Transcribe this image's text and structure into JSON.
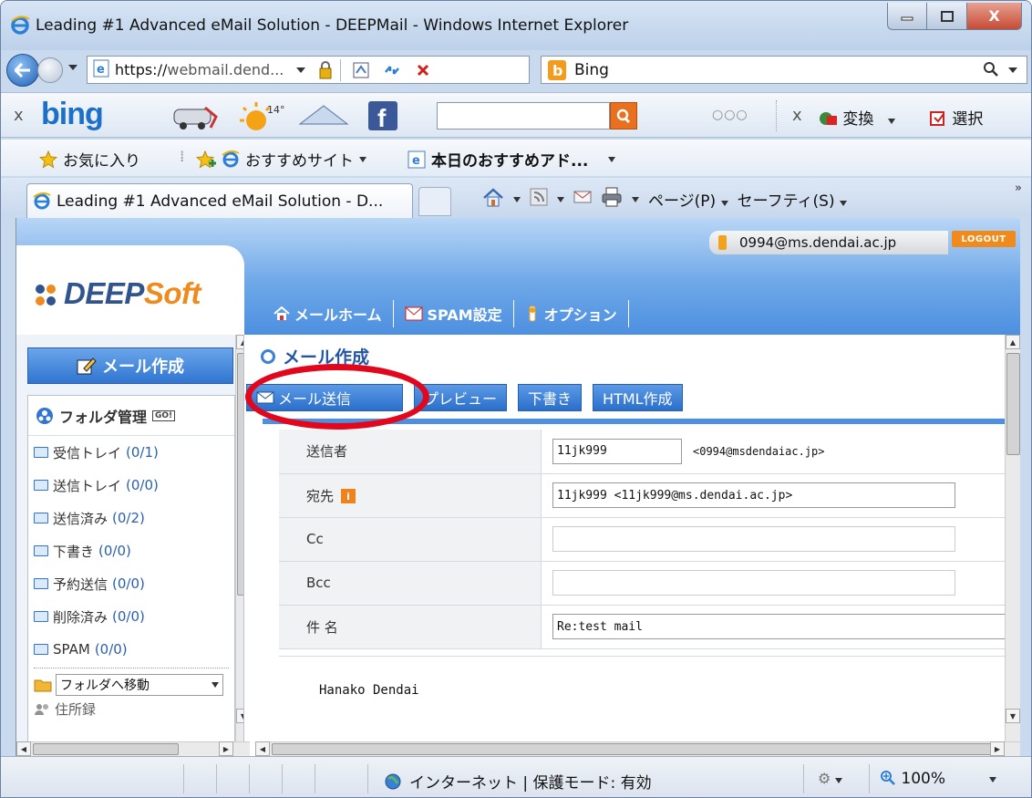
{
  "window": {
    "title": "Leading #1 Advanced eMail Solution - DEEPMail - Windows Internet Explorer"
  },
  "address_bar": {
    "url_prefix": "https://",
    "url_main": "webmail.dend...",
    "search_engine": "Bing"
  },
  "bing_toolbar": {
    "logo": "bing",
    "weather": "14°",
    "dots": "○○○",
    "convert_label": "変換",
    "select_label": "選択"
  },
  "favorites_bar": {
    "favorites_label": "お気に入り",
    "recommended_sites": "おすすめサイト",
    "todays_addons": "本日のおすすめアド..."
  },
  "tab_bar": {
    "active_tab_title": "Leading #1 Advanced eMail Solution - D...",
    "page_menu": "ページ(P)",
    "safety_menu": "セーフティ(S)",
    "chevron": "»"
  },
  "site": {
    "user_email": "0994@ms.dendai.ac.jp",
    "logout_label": "LOGOUT",
    "logo_main": "DEEP",
    "logo_accent": "Soft",
    "nav": [
      {
        "label": "メールホーム"
      },
      {
        "label": "SPAM設定"
      },
      {
        "label": "オプション"
      }
    ]
  },
  "sidebar": {
    "compose_label": "メール作成",
    "folder_manage_label": "フォルダ管理",
    "folder_go": "GO!",
    "folders": [
      {
        "name": "受信トレイ",
        "count": "(0/1)"
      },
      {
        "name": "送信トレイ",
        "count": "(0/0)"
      },
      {
        "name": "送信済み",
        "count": "(0/2)"
      },
      {
        "name": "下書き",
        "count": "(0/0)"
      },
      {
        "name": "予約送信",
        "count": "(0/0)"
      },
      {
        "name": "削除済み",
        "count": "(0/0)"
      },
      {
        "name": "SPAM",
        "count": "(0/0)"
      }
    ],
    "move_folder_label": "フォルダへ移動",
    "address_book_label": "住所録"
  },
  "compose": {
    "title": "メール作成",
    "buttons": {
      "send": "メール送信",
      "preview": "プレビュー",
      "draft": "下書き",
      "html": "HTML作成"
    },
    "fields": {
      "from_label": "送信者",
      "from_name": "11jk999",
      "from_address": "<0994@msdendaiac.jp>",
      "to_label": "宛先",
      "to_value": "11jk999 <11jk999@ms.dendai.ac.jp>",
      "cc_label": "Cc",
      "cc_value": "",
      "bcc_label": "Bcc",
      "bcc_value": "",
      "subject_label": "件 名",
      "subject_value": "Re:test mail"
    },
    "body": "Hanako Dendai"
  },
  "status_bar": {
    "zone": "インターネット | 保護モード: 有効",
    "zoom": "100%"
  },
  "colors": {
    "header_blue": "#4d8fe0",
    "button_blue": "#2b6fcb",
    "logo_orange": "#ef8b1c",
    "highlight_red": "#e1081e"
  }
}
